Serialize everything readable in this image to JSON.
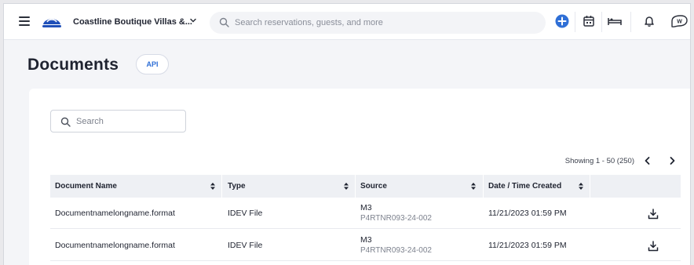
{
  "topbar": {
    "property_name": "Coastline Boutique Villas &...",
    "search_placeholder": "Search reservations, guests, and more",
    "icons": [
      "menu-icon",
      "logo-icon",
      "chevron-down-icon",
      "search-icon",
      "add-icon",
      "calendar-icon",
      "bed-icon",
      "bell-icon",
      "user-badge-icon"
    ],
    "user_initials": "W"
  },
  "page": {
    "title": "Documents",
    "api_badge": "API"
  },
  "documents": {
    "search_placeholder": "Search",
    "showing_text": "Showing 1 - 50  (250)",
    "columns": [
      "Document Name",
      "Type",
      "Source",
      "Date / Time Created"
    ],
    "rows": [
      {
        "name": "Documentnamelongname.format",
        "type": "IDEV File",
        "source": "M3",
        "source_id": "P4RTNR093-24-002",
        "created": "11/21/2023 01:59 PM"
      },
      {
        "name": "Documentnamelongname.format",
        "type": "IDEV File",
        "source": "M3",
        "source_id": "P4RTNR093-24-002",
        "created": "11/21/2023 01:59 PM"
      }
    ]
  },
  "colors": {
    "accent": "#2f6fd6",
    "brand_blue": "#1f4fb8",
    "header_bg": "#eef0f4",
    "page_bg": "#f4f5f8"
  }
}
